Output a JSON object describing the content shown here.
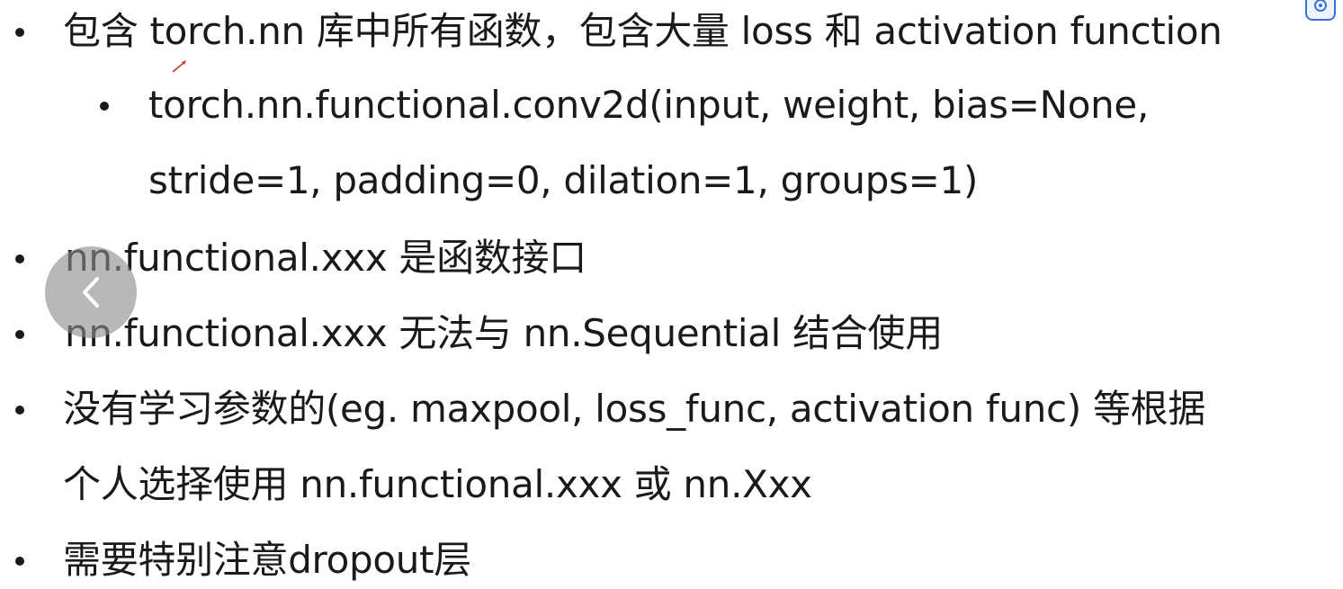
{
  "slide": {
    "items": [
      {
        "text": "包含 torch.nn 库中所有函数，包含大量 loss 和 activation function"
      },
      {
        "text": "torch.nn.functional.conv2d(input, weight, bias=None,"
      },
      {
        "text": "stride=1, padding=0, dilation=1, groups=1)"
      },
      {
        "text": "nn.functional.xxx 是函数接口"
      },
      {
        "text": "nn.functional.xxx 无法与 nn.Sequential 结合使用"
      },
      {
        "text": "没有学习参数的(eg. maxpool, loss_func, activation func) 等根据"
      },
      {
        "text": "个人选择使用 nn.functional.xxx 或 nn.Xxx"
      },
      {
        "text": "需要特别注意dropout层"
      }
    ]
  },
  "icons": {
    "back": "chevron-left-icon",
    "corner": "settings-icon",
    "pen": "pen-icon"
  },
  "colors": {
    "text": "#1a1a1a",
    "nav_button": "#8c8c8c",
    "pen_mark": "#c0392b",
    "corner_icon": "#3b6fd4"
  }
}
